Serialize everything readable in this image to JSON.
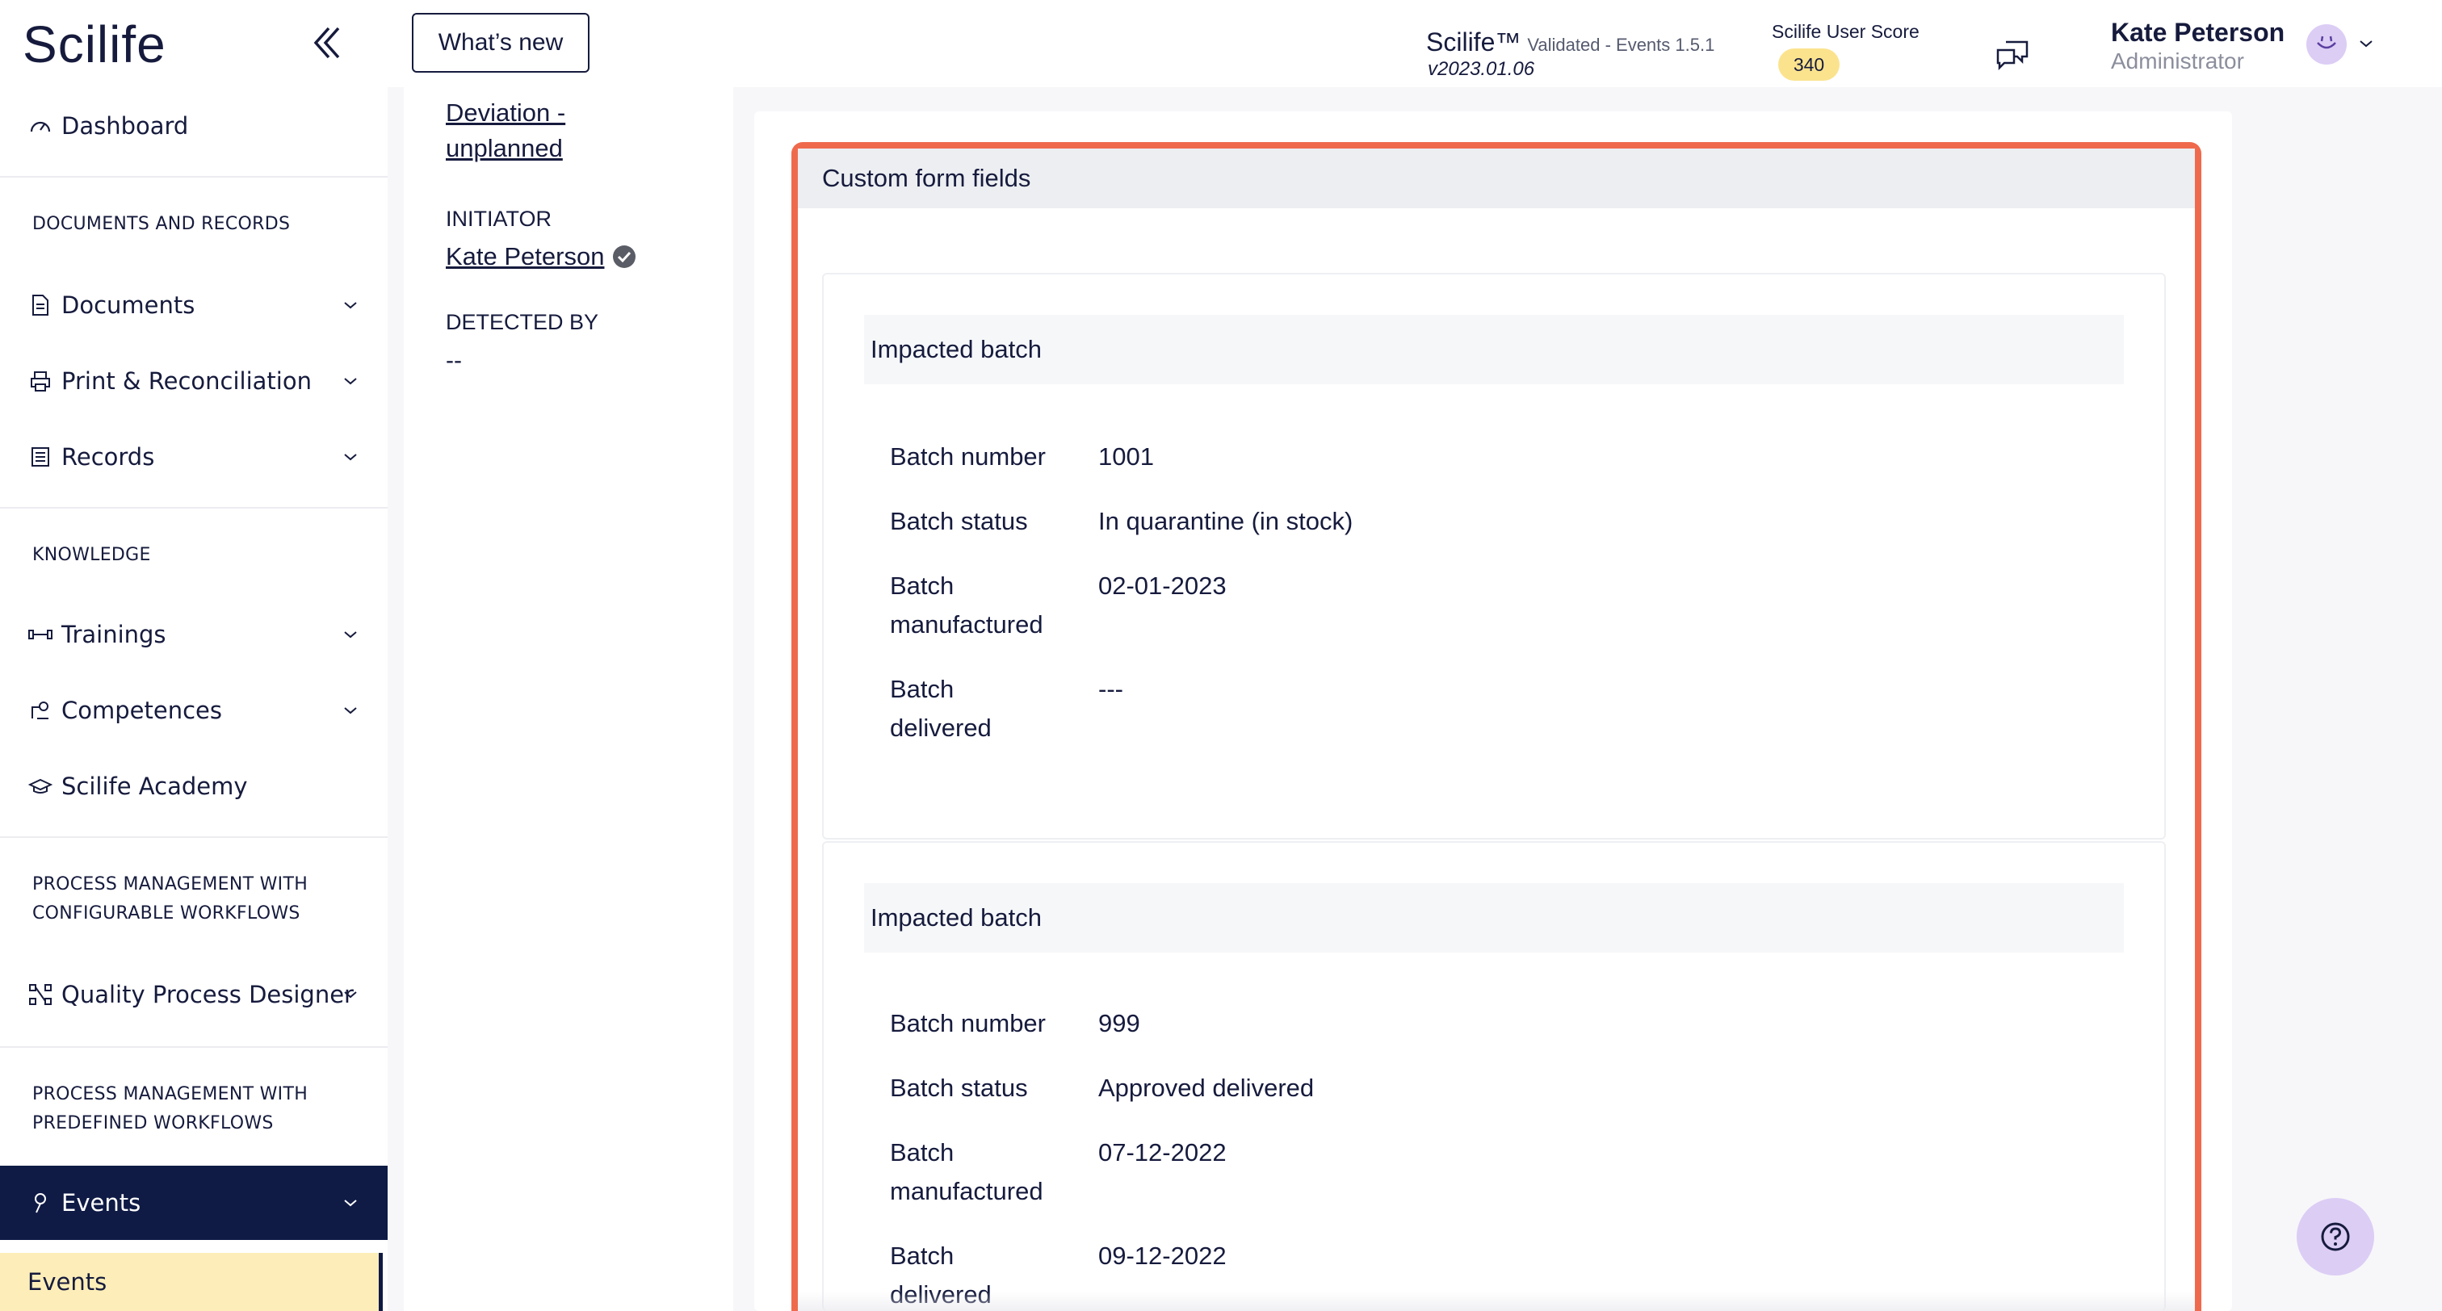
{
  "sidebar": {
    "logo": "Scilife",
    "dashboard": "Dashboard",
    "section_docs": "DOCUMENTS AND RECORDS",
    "documents": "Documents",
    "print": "Print & Reconciliation",
    "records": "Records",
    "section_knowledge": "KNOWLEDGE",
    "trainings": "Trainings",
    "competences": "Competences",
    "academy": "Scilife Academy",
    "section_configurable_1": "PROCESS MANAGEMENT WITH",
    "section_configurable_2": "CONFIGURABLE WORKFLOWS",
    "qpd": "Quality Process Designer",
    "section_predefined_1": "PROCESS MANAGEMENT WITH",
    "section_predefined_2": "PREDEFINED WORKFLOWS",
    "events": "Events",
    "events_sub": "Events"
  },
  "topbar": {
    "whats_new": "What’s new",
    "app_name": "Scilife™",
    "app_validated": "Validated - Events 1.5.1",
    "app_version": "v2023.01.06",
    "score_label": "Scilife User Score",
    "score_value": "340",
    "user_name": "Kate Peterson",
    "user_role": "Administrator"
  },
  "info": {
    "type_line1": "Deviation -",
    "type_line2": "unplanned",
    "initiator_label": "INITIATOR",
    "initiator_value": "Kate Peterson",
    "detected_label": "DETECTED BY",
    "detected_value": "--"
  },
  "custom_form": {
    "title": "Custom form fields",
    "batches": [
      {
        "title": "Impacted batch",
        "number_label": "Batch number",
        "number": "1001",
        "status_label": "Batch status",
        "status": "In quarantine (in stock)",
        "manufactured_label_1": "Batch",
        "manufactured_label_2": "manufactured",
        "manufactured": "02-01-2023",
        "delivered_label_1": "Batch",
        "delivered_label_2": "delivered",
        "delivered": "---"
      },
      {
        "title": "Impacted batch",
        "number_label": "Batch number",
        "number": "999",
        "status_label": "Batch status",
        "status": "Approved delivered",
        "manufactured_label_1": "Batch",
        "manufactured_label_2": "manufactured",
        "manufactured": "07-12-2022",
        "delivered_label_1": "Batch",
        "delivered_label_2": "delivered",
        "delivered": "09-12-2022"
      }
    ]
  },
  "colors": {
    "navy": "#0f1b45",
    "highlight": "#ef6a4d",
    "badge": "#fbe38e",
    "active_sub": "#fdeeb9",
    "avatar": "#dccdf5"
  }
}
